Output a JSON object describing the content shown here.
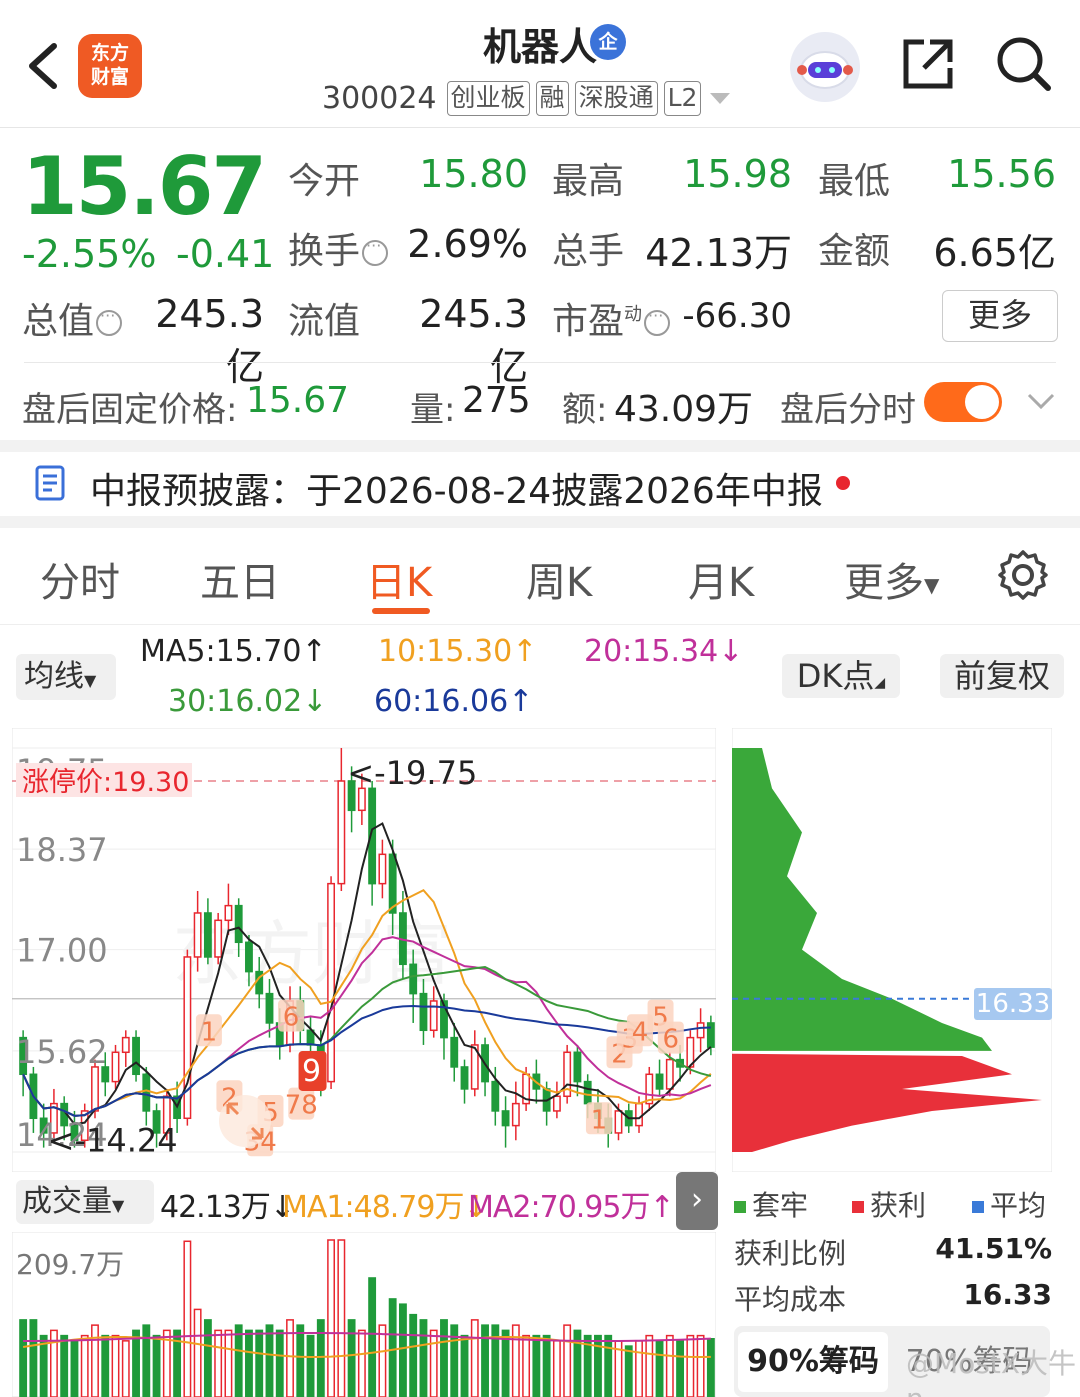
{
  "header": {
    "logo_line1": "东方",
    "logo_line2": "财富",
    "title": "机器人",
    "enterprise_badge": "企",
    "code": "300024",
    "tags": [
      "创业板",
      "融",
      "深股通",
      "L2"
    ]
  },
  "quote": {
    "price": "15.67",
    "change_pct": "-2.55%",
    "change_amt": "-0.41",
    "open_label": "今开",
    "open": "15.80",
    "high_label": "最高",
    "high": "15.98",
    "low_label": "最低",
    "low": "15.56",
    "turnover_label": "换手",
    "turnover": "2.69%",
    "volume_label": "总手",
    "volume": "42.13万",
    "amount_label": "金额",
    "amount": "6.65亿",
    "mktcap_label": "总值",
    "mktcap": "245.3亿",
    "float_label": "流值",
    "float": "245.3亿",
    "pe_label": "市盈",
    "pe_sup": "动",
    "pe": "-66.30",
    "more_button": "更多"
  },
  "afterhours": {
    "price_label": "盘后固定价格:",
    "price": "15.67",
    "vol_label": "量:",
    "vol": "275",
    "amt_label": "额:",
    "amt": "43.09万",
    "toggle_label": "盘后分时"
  },
  "notice": {
    "text": "中报预披露：于2026-08-24披露2026年中报"
  },
  "tabs": [
    {
      "label": "分时"
    },
    {
      "label": "五日"
    },
    {
      "label": "日K"
    },
    {
      "label": "周K"
    },
    {
      "label": "月K"
    },
    {
      "label": "更多"
    }
  ],
  "ma_legend": {
    "button": "均线",
    "ma5": "MA5:15.70↑",
    "ma10": "10:15.30↑",
    "ma20": "20:15.34↓",
    "ma30": "30:16.02↓",
    "ma60": "60:16.06↑",
    "dk_button": "DK点",
    "adjust_button": "前复权"
  },
  "colors": {
    "up": "#e8262e",
    "down": "#1f9a3a",
    "ma5": "#222222",
    "ma10": "#f0a020",
    "ma20": "#c0309a",
    "ma30": "#3a9a3a",
    "ma60": "#1a3a9a"
  },
  "chart_data": {
    "type": "candlestick",
    "y_ticks": [
      "19.75",
      "18.37",
      "17.00",
      "15.62",
      "14.24"
    ],
    "ylim": [
      14.24,
      19.75
    ],
    "limit_up_label": "涨停价:19.30",
    "limit_up": 19.3,
    "max_label": "<-19.75",
    "min_label": "<-14.24",
    "watermark": "东方财富",
    "candles": [
      [
        15.8,
        15.3,
        15.9,
        15.0
      ],
      [
        15.3,
        14.7,
        15.4,
        14.5
      ],
      [
        14.7,
        14.5,
        14.9,
        14.3
      ],
      [
        14.5,
        14.9,
        15.1,
        14.4
      ],
      [
        14.9,
        14.6,
        15.0,
        14.4
      ],
      [
        14.6,
        14.4,
        14.8,
        14.3
      ],
      [
        14.4,
        14.8,
        14.9,
        14.3
      ],
      [
        14.8,
        15.4,
        15.5,
        14.7
      ],
      [
        15.4,
        15.2,
        15.6,
        15.0
      ],
      [
        15.2,
        15.6,
        15.7,
        15.1
      ],
      [
        15.6,
        15.8,
        15.9,
        15.4
      ],
      [
        15.8,
        15.3,
        15.9,
        15.2
      ],
      [
        15.3,
        14.8,
        15.4,
        14.6
      ],
      [
        14.8,
        14.5,
        14.9,
        14.3
      ],
      [
        14.5,
        15.0,
        15.1,
        14.4
      ],
      [
        15.0,
        14.7,
        15.2,
        14.5
      ],
      [
        14.7,
        16.9,
        17.0,
        14.6
      ],
      [
        16.9,
        17.5,
        17.8,
        16.7
      ],
      [
        17.5,
        16.9,
        17.7,
        16.8
      ],
      [
        16.9,
        17.4,
        17.5,
        16.8
      ],
      [
        17.4,
        17.6,
        17.9,
        17.2
      ],
      [
        17.6,
        17.1,
        17.7,
        16.9
      ],
      [
        17.1,
        16.7,
        17.2,
        16.5
      ],
      [
        16.7,
        16.4,
        16.9,
        16.2
      ],
      [
        16.4,
        16.0,
        16.6,
        15.8
      ],
      [
        16.0,
        15.7,
        16.2,
        15.5
      ],
      [
        15.7,
        16.3,
        16.5,
        15.6
      ],
      [
        16.3,
        15.9,
        16.5,
        15.7
      ],
      [
        15.9,
        15.7,
        16.1,
        15.5
      ],
      [
        15.7,
        15.2,
        15.9,
        15.0
      ],
      [
        15.2,
        17.9,
        18.0,
        15.1
      ],
      [
        17.9,
        19.3,
        19.75,
        17.8
      ],
      [
        19.3,
        18.9,
        19.5,
        18.6
      ],
      [
        18.9,
        19.2,
        19.4,
        18.7
      ],
      [
        19.2,
        17.9,
        19.3,
        17.6
      ],
      [
        17.9,
        18.3,
        18.5,
        17.7
      ],
      [
        18.3,
        17.5,
        18.5,
        17.2
      ],
      [
        17.5,
        16.8,
        17.8,
        16.6
      ],
      [
        16.8,
        16.4,
        17.0,
        16.0
      ],
      [
        16.4,
        15.9,
        16.6,
        15.7
      ],
      [
        15.9,
        16.3,
        16.5,
        15.8
      ],
      [
        16.3,
        15.8,
        16.4,
        15.5
      ],
      [
        15.8,
        15.4,
        16.0,
        15.2
      ],
      [
        15.4,
        15.1,
        15.5,
        14.9
      ],
      [
        15.1,
        15.7,
        15.9,
        15.0
      ],
      [
        15.7,
        15.2,
        15.8,
        15.0
      ],
      [
        15.2,
        14.8,
        15.4,
        14.6
      ],
      [
        14.8,
        14.6,
        15.0,
        14.3
      ],
      [
        14.6,
        14.9,
        15.2,
        14.4
      ],
      [
        14.9,
        15.3,
        15.4,
        14.8
      ],
      [
        15.3,
        15.1,
        15.5,
        14.9
      ],
      [
        15.1,
        14.8,
        15.2,
        14.6
      ],
      [
        14.8,
        15.0,
        15.2,
        14.7
      ],
      [
        15.0,
        15.6,
        15.7,
        14.9
      ],
      [
        15.6,
        15.2,
        15.7,
        15.0
      ],
      [
        15.2,
        14.9,
        15.3,
        14.7
      ],
      [
        14.9,
        14.7,
        15.1,
        14.5
      ],
      [
        14.7,
        14.5,
        14.9,
        14.3
      ],
      [
        14.5,
        14.8,
        14.9,
        14.4
      ],
      [
        14.8,
        14.6,
        14.9,
        14.5
      ],
      [
        14.6,
        14.9,
        15.0,
        14.5
      ],
      [
        14.9,
        15.3,
        15.4,
        14.8
      ],
      [
        15.3,
        15.1,
        15.5,
        15.0
      ],
      [
        15.1,
        15.5,
        15.6,
        15.0
      ],
      [
        15.5,
        15.4,
        15.7,
        15.2
      ],
      [
        15.4,
        15.8,
        15.9,
        15.3
      ],
      [
        15.8,
        16.0,
        16.2,
        15.6
      ],
      [
        16.0,
        15.67,
        16.1,
        15.56
      ]
    ],
    "price_marker": "16.33"
  },
  "markers": [
    "1",
    "2",
    "5",
    "34",
    "6",
    "78",
    "9",
    "1",
    "2",
    "3",
    "4",
    "5",
    "6"
  ],
  "volume": {
    "button": "成交量",
    "vol": "42.13万↓",
    "ma1": "MA1:48.79万↓",
    "ma2": "MA2:70.95万↑",
    "y_tick": "209.7万"
  },
  "chips": {
    "legend": [
      "套牢",
      "获利",
      "平均"
    ],
    "profit_label": "获利比例",
    "profit": "41.51%",
    "cost_label": "平均成本",
    "cost": "16.33",
    "btn90": "90%筹码",
    "btn70": "70%筹码",
    "price_marker": "16.33"
  },
  "watermark_text": "@MostX大牛n"
}
